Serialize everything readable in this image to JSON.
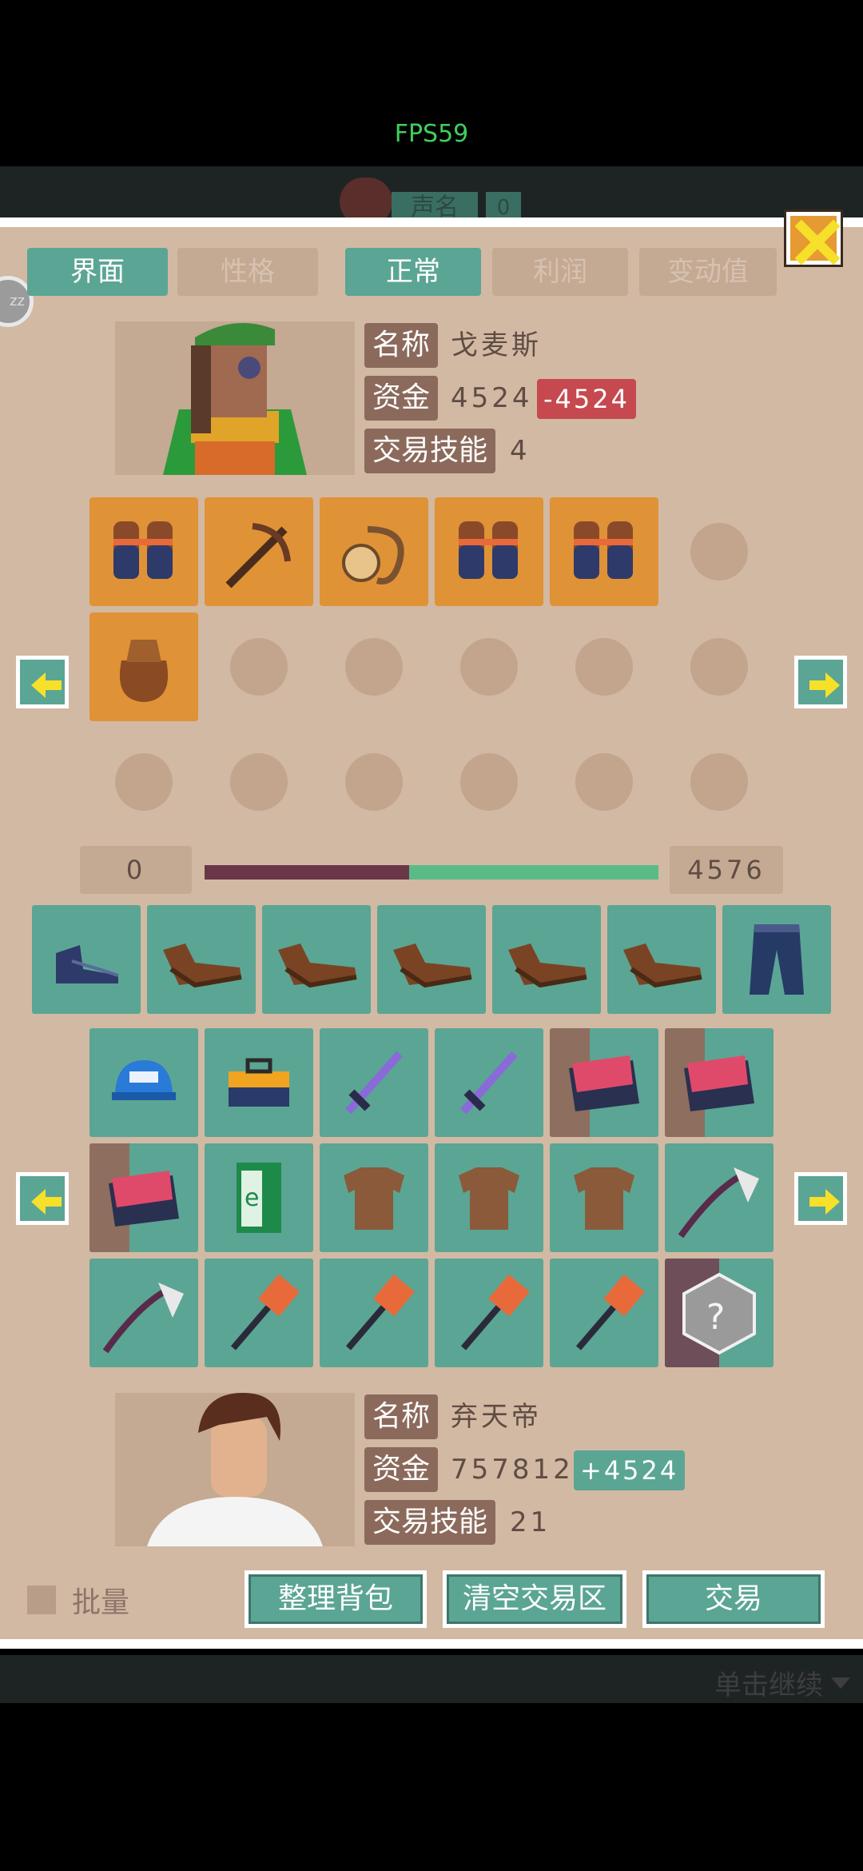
{
  "fps": "FPS59",
  "background": {
    "tag": "声名",
    "count": "0"
  },
  "tabs": {
    "left": [
      "界面",
      "性格"
    ],
    "right": [
      "正常",
      "利润",
      "变动值"
    ]
  },
  "trader": {
    "name_label": "名称",
    "name": "戈麦斯",
    "funds_label": "资金",
    "funds": "4524",
    "funds_delta": "-4524",
    "skill_label": "交易技能",
    "skill": "4"
  },
  "trade_offer": {
    "items": [
      "gloves-icon",
      "crossbow-icon",
      "rope-icon",
      "gloves-icon",
      "gloves-icon",
      "pouch-icon"
    ],
    "empty_slots": 12
  },
  "balance": {
    "left": "0",
    "right": "4576",
    "fraction_left": 0.45
  },
  "player": {
    "name_label": "名称",
    "name": "弃天帝",
    "funds_label": "资金",
    "funds": "757812",
    "funds_delta": "+4524",
    "skill_label": "交易技能",
    "skill": "21"
  },
  "inventory": {
    "row0": [
      "boots-icon",
      "shoes-icon",
      "shoes-icon",
      "shoes-icon",
      "shoes-icon",
      "shoes-icon",
      "pants-icon"
    ],
    "grid": [
      "cap-icon",
      "toolbox-icon",
      "sword-icon",
      "sword-icon",
      "book-icon",
      "book-icon",
      "book-icon",
      "ebook-icon",
      "armor-icon",
      "armor-icon",
      "armor-icon",
      "axe-icon",
      "axe-icon",
      "hammer-icon",
      "hammer-icon",
      "hammer-icon",
      "hammer-icon",
      "mystery-box-icon"
    ]
  },
  "footer": {
    "batch_label": "批量",
    "sort_label": "整理背包",
    "clear_label": "清空交易区",
    "trade_label": "交易",
    "continue_label": "单击继续"
  },
  "colors": {
    "teal": "#5ba594",
    "orange": "#e09236",
    "panel": "#d2b9a3",
    "negative": "#c5494e",
    "positive": "#5ba594"
  }
}
